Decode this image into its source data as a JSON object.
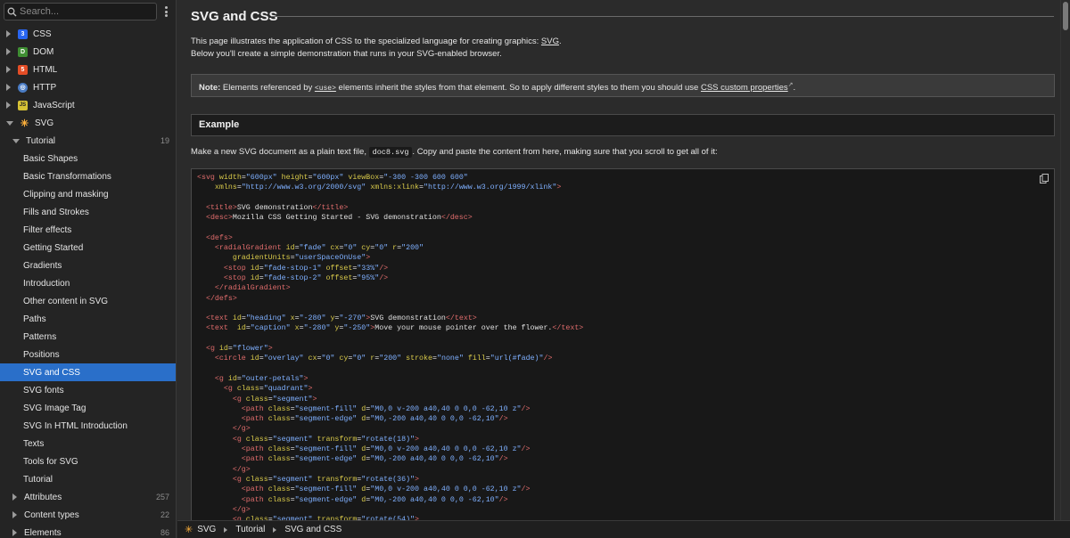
{
  "search": {
    "placeholder": "Search..."
  },
  "sidebar": {
    "top_items": [
      {
        "label": "CSS",
        "icon": "css-icon",
        "color": "#2965f1"
      },
      {
        "label": "DOM",
        "icon": "dom-icon",
        "color": "#3f8f33"
      },
      {
        "label": "HTML",
        "icon": "html-icon",
        "color": "#e44d26"
      },
      {
        "label": "HTTP",
        "icon": "http-icon",
        "color": "#4a7cc4"
      },
      {
        "label": "JavaScript",
        "icon": "javascript-icon",
        "color": "#d6c235"
      },
      {
        "label": "SVG",
        "icon": "svg-icon",
        "color": "#ffb13b"
      }
    ],
    "tutorial": {
      "label": "Tutorial",
      "count": "19"
    },
    "tutorial_items": [
      "Basic Shapes",
      "Basic Transformations",
      "Clipping and masking",
      "Fills and Strokes",
      "Filter effects",
      "Getting Started",
      "Gradients",
      "Introduction",
      "Other content in SVG",
      "Paths",
      "Patterns",
      "Positions",
      "SVG and CSS",
      "SVG fonts",
      "SVG Image Tag",
      "SVG In HTML Introduction",
      "Texts",
      "Tools for SVG",
      "Tutorial"
    ],
    "active_index": 12,
    "more_items": [
      {
        "label": "Attributes",
        "count": "257"
      },
      {
        "label": "Content types",
        "count": "22"
      },
      {
        "label": "Elements",
        "count": "86"
      }
    ]
  },
  "main": {
    "title": "SVG and CSS",
    "intro_line1_pre": "This page illustrates the application of CSS to the specialized language for creating graphics: ",
    "intro_line1_link": "SVG",
    "intro_line1_post": ".",
    "intro_line2": "Below you'll create a simple demonstration that runs in your SVG-enabled browser.",
    "note_label": "Note:",
    "note_pre": " Elements referenced by ",
    "note_code": "<use>",
    "note_mid": " elements inherit the styles from that element. So to apply different styles to them you should use ",
    "note_link": "CSS custom properties",
    "note_post": ".",
    "example_heading": "Example",
    "para_pre": "Make a new SVG document as a plain text file, ",
    "para_file": "doc8.svg",
    "para_post": ". Copy and paste the content from here, making sure that you scroll to get all of it:"
  },
  "breadcrumb": [
    "SVG",
    "Tutorial",
    "SVG and CSS"
  ]
}
